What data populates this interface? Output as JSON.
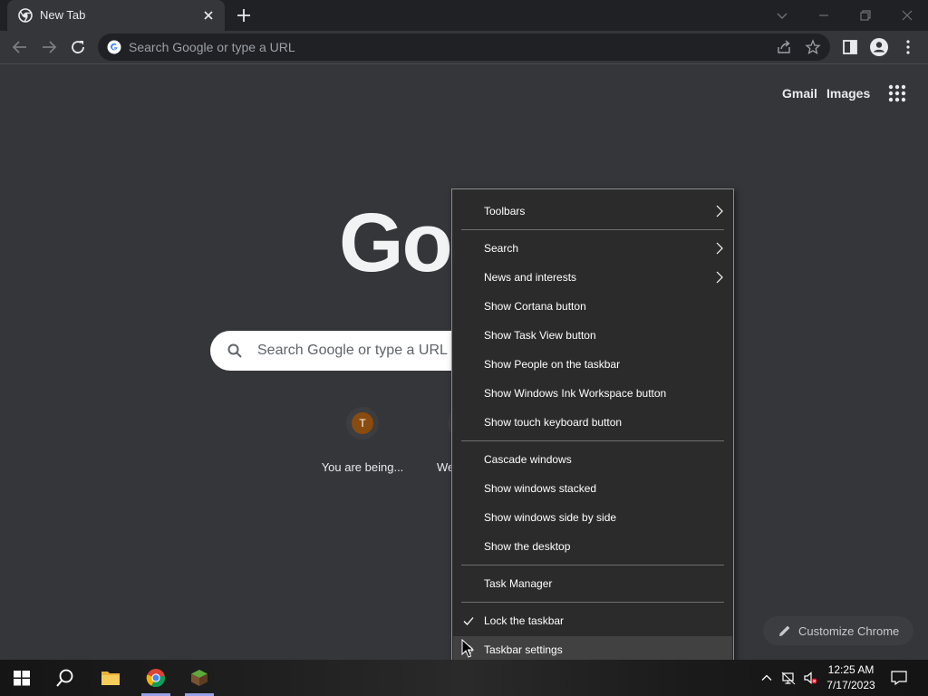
{
  "browser": {
    "tab_title": "New Tab",
    "omnibox_placeholder": "Search Google or type a URL"
  },
  "ntp": {
    "links": [
      "Gmail",
      "Images"
    ],
    "logo_partial": "Goo",
    "search_placeholder": "Search Google or type a URL",
    "shortcuts": [
      {
        "letter": "T",
        "label": "You are being..."
      },
      {
        "letter": "",
        "label": "We"
      }
    ],
    "customize_label": "Customize Chrome"
  },
  "context_menu": {
    "items": [
      {
        "label": "Toolbars",
        "submenu": true
      },
      {
        "label": "Search",
        "submenu": true
      },
      {
        "label": "News and interests",
        "submenu": true
      },
      {
        "label": "Show Cortana button"
      },
      {
        "label": "Show Task View button"
      },
      {
        "label": "Show People on the taskbar"
      },
      {
        "label": "Show Windows Ink Workspace button"
      },
      {
        "label": "Show touch keyboard button"
      },
      {
        "label": "Cascade windows"
      },
      {
        "label": "Show windows stacked"
      },
      {
        "label": "Show windows side by side"
      },
      {
        "label": "Show the desktop"
      },
      {
        "label": "Task Manager"
      },
      {
        "label": "Lock the taskbar",
        "checked": true
      },
      {
        "label": "Taskbar settings",
        "hovered": true
      }
    ]
  },
  "taskbar": {
    "time": "12:25 AM",
    "date": "7/17/2023"
  },
  "colors": {
    "page_bg": "#35363a",
    "tabstrip_bg": "#202124",
    "menu_bg": "#2b2b2b",
    "menu_hover": "#414141",
    "shortcut_avatar": "#8a4b0f"
  }
}
